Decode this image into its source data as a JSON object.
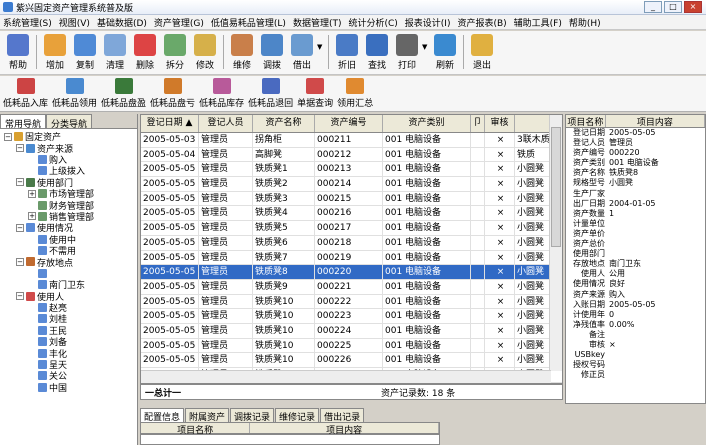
{
  "window": {
    "title": "紫兴固定资产管理系统普及版"
  },
  "menu": [
    "系统管理(S)",
    "视图(V)",
    "基础数据(D)",
    "资产管理(G)",
    "低值易耗品管理(L)",
    "数据管理(T)",
    "统计分析(C)",
    "报表设计(I)",
    "资产报表(B)",
    "辅助工具(F)",
    "帮助(H)"
  ],
  "toolbar": [
    {
      "label": "帮助",
      "color": "#5577cc",
      "dd": false,
      "sepAfter": true
    },
    {
      "label": "增加",
      "color": "#e8a13a",
      "dd": false
    },
    {
      "label": "复制",
      "color": "#4f8ad6",
      "dd": false
    },
    {
      "label": "清理",
      "color": "#7fa7d9",
      "dd": false
    },
    {
      "label": "删除",
      "color": "#d44",
      "dd": false
    },
    {
      "label": "拆分",
      "color": "#6aa96a",
      "dd": false
    },
    {
      "label": "修改",
      "color": "#d6b04a",
      "dd": false,
      "sepAfter": true
    },
    {
      "label": "维修",
      "color": "#c97f4a",
      "dd": false
    },
    {
      "label": "调拨",
      "color": "#4d86c8",
      "dd": false
    },
    {
      "label": "借出",
      "color": "#6a9bd0",
      "dd": true,
      "sepAfter": true
    },
    {
      "label": "折旧",
      "color": "#4a7bc6",
      "dd": false
    },
    {
      "label": "查找",
      "color": "#3a6fbf",
      "dd": false
    },
    {
      "label": "打印",
      "color": "#666",
      "dd": true
    },
    {
      "label": "刷新",
      "color": "#3a8ad0",
      "dd": false,
      "sepAfter": true
    },
    {
      "label": "退出",
      "color": "#e0b040",
      "dd": false
    }
  ],
  "toolbar2": [
    {
      "label": "低耗品入库",
      "color": "#c44"
    },
    {
      "label": "低耗品领用",
      "color": "#4a8ad0"
    },
    {
      "label": "低耗品盘盈",
      "color": "#3a7a3a"
    },
    {
      "label": "低耗品盘亏",
      "color": "#d07a2a"
    },
    {
      "label": "低耗品库存",
      "color": "#b85a9a"
    },
    {
      "label": "低耗品退回",
      "color": "#4a6ac0"
    },
    {
      "label": "单据查询",
      "color": "#d04a4a"
    },
    {
      "label": "领用汇总",
      "color": "#e08a30"
    }
  ],
  "tabs": [
    "常用导航",
    "分类导航"
  ],
  "tree": [
    {
      "level": 0,
      "expander": "−",
      "icon": "#d9a030",
      "label": "固定资产"
    },
    {
      "level": 1,
      "expander": "−",
      "icon": "#4a8ad0",
      "label": "资产来源"
    },
    {
      "level": 2,
      "expander": "",
      "icon": "#5a8ad6",
      "label": "购入"
    },
    {
      "level": 2,
      "expander": "",
      "icon": "#5a8ad6",
      "label": "上级拨入"
    },
    {
      "level": 1,
      "expander": "−",
      "icon": "#4a7a4a",
      "label": "使用部门"
    },
    {
      "level": 2,
      "expander": "+",
      "icon": "#6a9a6a",
      "label": "市场管理部"
    },
    {
      "level": 2,
      "expander": "",
      "icon": "#6a9a6a",
      "label": "财务管理部"
    },
    {
      "level": 2,
      "expander": "+",
      "icon": "#6a9a6a",
      "label": "销售管理部"
    },
    {
      "level": 1,
      "expander": "−",
      "icon": "#5a8ad6",
      "label": "使用情况"
    },
    {
      "level": 2,
      "expander": "",
      "icon": "#5a8ad6",
      "label": "使用中"
    },
    {
      "level": 2,
      "expander": "",
      "icon": "#5a8ad6",
      "label": "不需用"
    },
    {
      "level": 1,
      "expander": "−",
      "icon": "#c06a30",
      "label": "存放地点"
    },
    {
      "level": 2,
      "expander": "",
      "icon": "#5a8ad6",
      "label": ""
    },
    {
      "level": 2,
      "expander": "",
      "icon": "#5a8ad6",
      "label": "南门卫东"
    },
    {
      "level": 1,
      "expander": "−",
      "icon": "#d04a4a",
      "label": "使用人"
    },
    {
      "level": 2,
      "expander": "",
      "icon": "#5a8ad6",
      "label": "赵亮"
    },
    {
      "level": 2,
      "expander": "",
      "icon": "#5a8ad6",
      "label": "刘桂"
    },
    {
      "level": 2,
      "expander": "",
      "icon": "#5a8ad6",
      "label": "王民"
    },
    {
      "level": 2,
      "expander": "",
      "icon": "#5a8ad6",
      "label": "刘备"
    },
    {
      "level": 2,
      "expander": "",
      "icon": "#5a8ad6",
      "label": "丰化"
    },
    {
      "level": 2,
      "expander": "",
      "icon": "#5a8ad6",
      "label": "呈天"
    },
    {
      "level": 2,
      "expander": "",
      "icon": "#5a8ad6",
      "label": "关公"
    },
    {
      "level": 2,
      "expander": "",
      "icon": "#5a8ad6",
      "label": "中国"
    }
  ],
  "grid": {
    "columns": [
      "登记日期 ▲",
      "登记人员",
      "资产名称",
      "资产编号",
      "资产类别",
      "卩",
      "审核",
      ""
    ],
    "rows": [
      [
        "2005-05-03",
        "管理员",
        "拐角柜",
        "000211",
        "001 电脑设备",
        "",
        "×",
        "3联木质"
      ],
      [
        "2005-05-04",
        "管理员",
        "高脚凳",
        "000212",
        "001 电脑设备",
        "",
        "×",
        "铁质"
      ],
      [
        "2005-05-05",
        "管理员",
        "铁质凳1",
        "000213",
        "001 电脑设备",
        "",
        "×",
        "小圆凳"
      ],
      [
        "2005-05-05",
        "管理员",
        "铁质凳2",
        "000214",
        "001 电脑设备",
        "",
        "×",
        "小圆凳"
      ],
      [
        "2005-05-05",
        "管理员",
        "铁质凳3",
        "000215",
        "001 电脑设备",
        "",
        "×",
        "小圆凳"
      ],
      [
        "2005-05-05",
        "管理员",
        "铁质凳4",
        "000216",
        "001 电脑设备",
        "",
        "×",
        "小圆凳"
      ],
      [
        "2005-05-05",
        "管理员",
        "铁质凳5",
        "000217",
        "001 电脑设备",
        "",
        "×",
        "小圆凳"
      ],
      [
        "2005-05-05",
        "管理员",
        "铁质凳6",
        "000218",
        "001 电脑设备",
        "",
        "×",
        "小圆凳"
      ],
      [
        "2005-05-05",
        "管理员",
        "铁质凳7",
        "000219",
        "001 电脑设备",
        "",
        "×",
        "小圆凳"
      ],
      [
        "2005-05-05",
        "管理员",
        "铁质凳8",
        "000220",
        "001 电脑设备",
        "",
        "×",
        "小圆凳"
      ],
      [
        "2005-05-05",
        "管理员",
        "铁质凳9",
        "000221",
        "001 电脑设备",
        "",
        "×",
        "小圆凳"
      ],
      [
        "2005-05-05",
        "管理员",
        "铁质凳10",
        "000222",
        "001 电脑设备",
        "",
        "×",
        "小圆凳"
      ],
      [
        "2005-05-05",
        "管理员",
        "铁质凳10",
        "000223",
        "001 电脑设备",
        "",
        "×",
        "小圆凳"
      ],
      [
        "2005-05-05",
        "管理员",
        "铁质凳10",
        "000224",
        "001 电脑设备",
        "",
        "×",
        "小圆凳"
      ],
      [
        "2005-05-05",
        "管理员",
        "铁质凳10",
        "000225",
        "001 电脑设备",
        "",
        "×",
        "小圆凳"
      ],
      [
        "2005-05-05",
        "管理员",
        "铁质凳10",
        "000226",
        "001 电脑设备",
        "",
        "×",
        "小圆凳"
      ],
      [
        "2005-05-05",
        "管理员",
        "铁质凳10",
        "000227",
        "001 电脑设备",
        "",
        "×",
        "小圆凳"
      ]
    ],
    "selected": 9,
    "total_label": "一总计一",
    "count_text": "资产记录数: 18 条"
  },
  "detail": {
    "headers": [
      "项目名称",
      "项目内容"
    ],
    "rows": [
      [
        "登记日期",
        "2005-05-05"
      ],
      [
        "登记人员",
        "管理员"
      ],
      [
        "资产编号",
        "000220"
      ],
      [
        "资产类别",
        "001 电脑设备"
      ],
      [
        "资产名称",
        "铁质凳8"
      ],
      [
        "规格型号",
        "小圆凳"
      ],
      [
        "生产厂家",
        ""
      ],
      [
        "出厂日期",
        "2004-01-05"
      ],
      [
        "资产数量",
        "1"
      ],
      [
        "计量单位",
        ""
      ],
      [
        "资产单价",
        ""
      ],
      [
        "资产总价",
        ""
      ],
      [
        "使用部门",
        ""
      ],
      [
        "存放地点",
        "南门卫东"
      ],
      [
        "使用人",
        "公用"
      ],
      [
        "使用情况",
        "良好"
      ],
      [
        "资产来源",
        "购入"
      ],
      [
        "入账日期",
        "2005-05-05"
      ],
      [
        "计使用年",
        "0"
      ],
      [
        "净残值率",
        "0.00%"
      ],
      [
        "备注",
        ""
      ],
      [
        "审核",
        "×"
      ],
      [
        "USBkey",
        ""
      ],
      [
        "授权号码",
        ""
      ],
      [
        "修正员",
        ""
      ]
    ]
  },
  "bottom_tabs": [
    "配置信息",
    "附属资产",
    "调拨记录",
    "维修记录",
    "借出记录"
  ],
  "bottom_headers": [
    "项目名称",
    "项目内容"
  ]
}
